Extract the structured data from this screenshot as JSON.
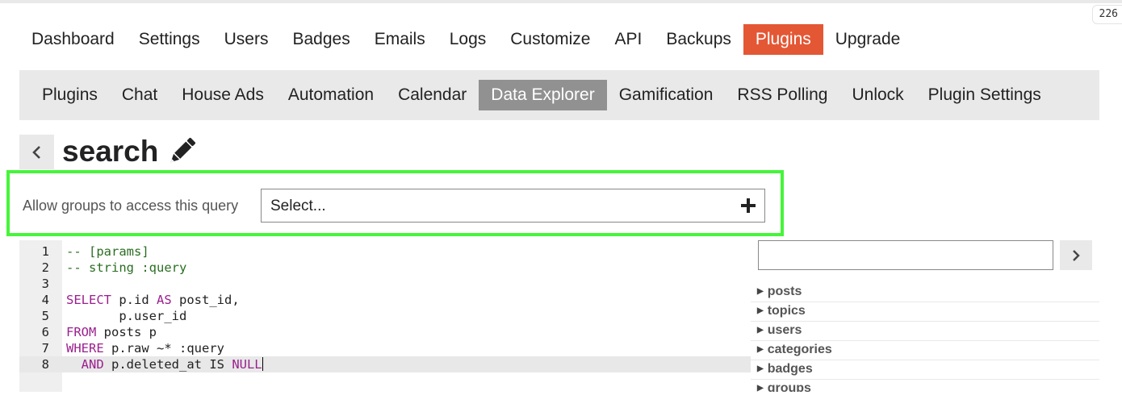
{
  "top_badge": "226",
  "admin_nav": {
    "items": [
      {
        "label": "Dashboard",
        "active": false
      },
      {
        "label": "Settings",
        "active": false
      },
      {
        "label": "Users",
        "active": false
      },
      {
        "label": "Badges",
        "active": false
      },
      {
        "label": "Emails",
        "active": false
      },
      {
        "label": "Logs",
        "active": false
      },
      {
        "label": "Customize",
        "active": false
      },
      {
        "label": "API",
        "active": false
      },
      {
        "label": "Backups",
        "active": false
      },
      {
        "label": "Plugins",
        "active": true
      },
      {
        "label": "Upgrade",
        "active": false
      }
    ]
  },
  "plugin_nav": {
    "items": [
      {
        "label": "Plugins",
        "active": false
      },
      {
        "label": "Chat",
        "active": false
      },
      {
        "label": "House Ads",
        "active": false
      },
      {
        "label": "Automation",
        "active": false
      },
      {
        "label": "Calendar",
        "active": false
      },
      {
        "label": "Data Explorer",
        "active": true
      },
      {
        "label": "Gamification",
        "active": false
      },
      {
        "label": "RSS Polling",
        "active": false
      },
      {
        "label": "Unlock",
        "active": false
      },
      {
        "label": "Plugin Settings",
        "active": false
      }
    ]
  },
  "query": {
    "name": "search",
    "back_icon": "chevron-left-icon",
    "edit_icon": "pencil-icon"
  },
  "groups": {
    "label": "Allow groups to access this query",
    "placeholder": "Select...",
    "add_icon": "plus-icon"
  },
  "editor": {
    "active_line": 8,
    "lines": [
      {
        "number": "1",
        "tokens": [
          {
            "t": "-- [params]",
            "k": "comment"
          }
        ]
      },
      {
        "number": "2",
        "tokens": [
          {
            "t": "-- string :query",
            "k": "comment"
          }
        ]
      },
      {
        "number": "3",
        "tokens": []
      },
      {
        "number": "4",
        "tokens": [
          {
            "t": "SELECT",
            "k": "kw"
          },
          {
            "t": " p.id ",
            "k": "plain"
          },
          {
            "t": "AS",
            "k": "kw"
          },
          {
            "t": " post_id,",
            "k": "plain"
          }
        ]
      },
      {
        "number": "5",
        "tokens": [
          {
            "t": "       p.user_id",
            "k": "plain"
          }
        ]
      },
      {
        "number": "6",
        "tokens": [
          {
            "t": "FROM",
            "k": "kw"
          },
          {
            "t": " posts p",
            "k": "plain"
          }
        ]
      },
      {
        "number": "7",
        "tokens": [
          {
            "t": "WHERE",
            "k": "kw"
          },
          {
            "t": " p.raw ~* :query",
            "k": "plain"
          }
        ]
      },
      {
        "number": "8",
        "tokens": [
          {
            "t": "  ",
            "k": "plain"
          },
          {
            "t": "AND",
            "k": "kw"
          },
          {
            "t": " p.deleted_at IS ",
            "k": "plain"
          },
          {
            "t": "NULL",
            "k": "kw"
          }
        ]
      }
    ]
  },
  "schema": {
    "search_value": "",
    "go_icon": "chevron-right-icon",
    "tables": [
      "posts",
      "topics",
      "users",
      "categories",
      "badges",
      "groups"
    ]
  },
  "colors": {
    "accent": "#e45735",
    "active_subnav": "#919191",
    "highlight_border": "#46f53a",
    "sql_keyword": "#9b1f8e",
    "sql_comment": "#2a6e22"
  }
}
